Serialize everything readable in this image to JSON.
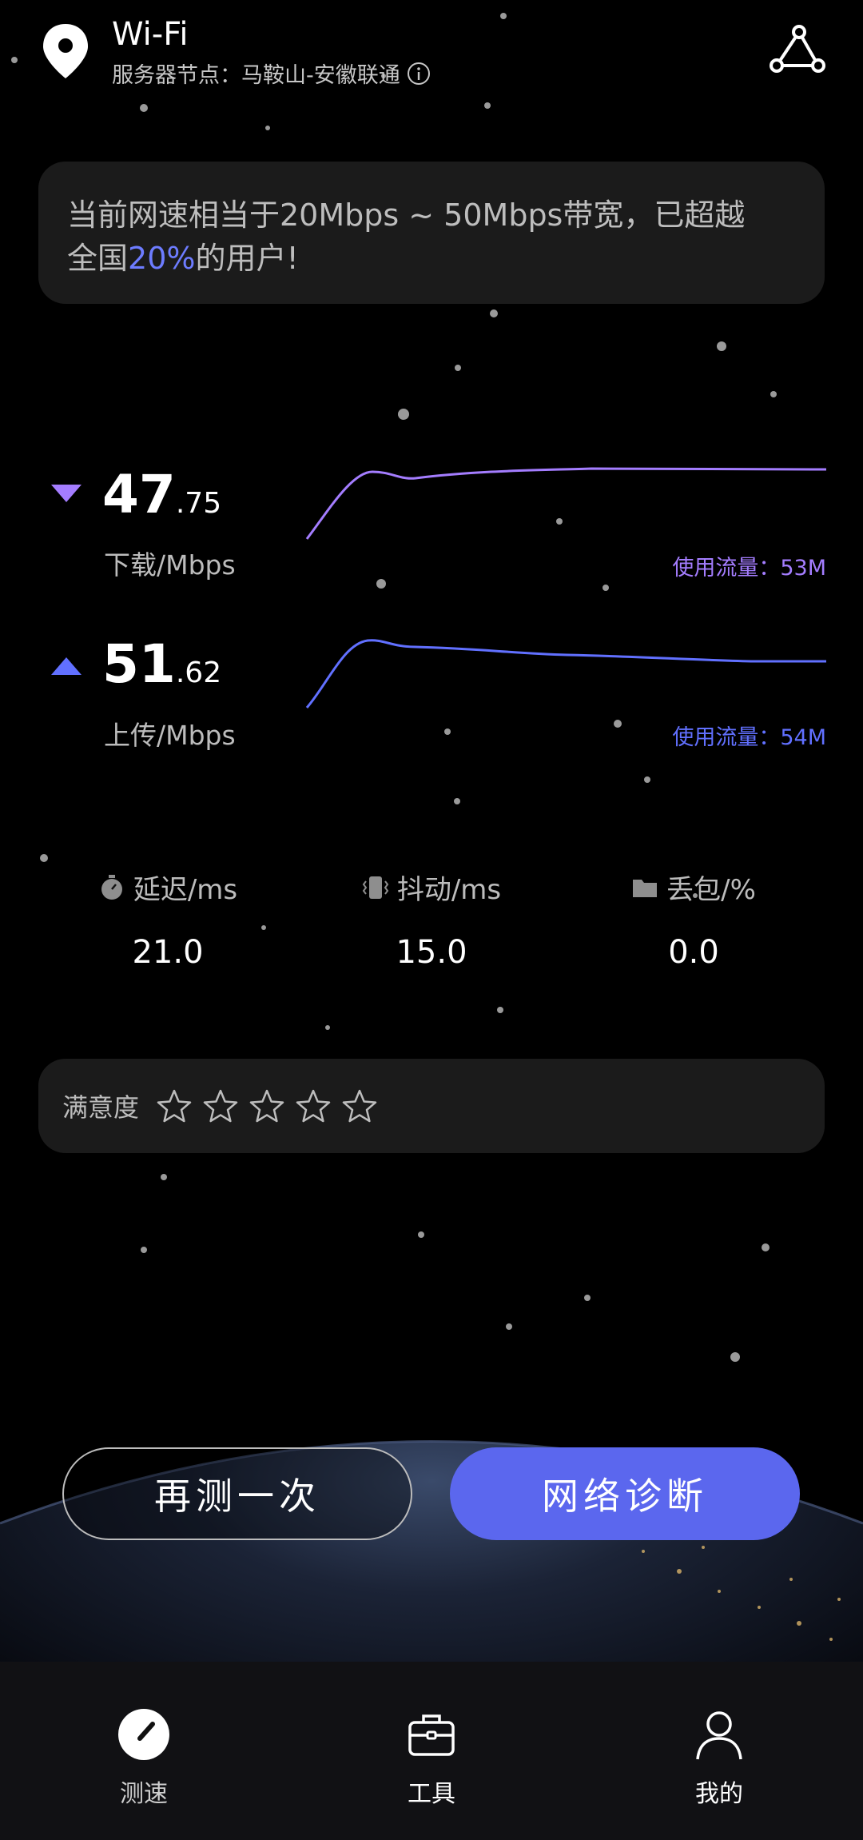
{
  "header": {
    "title": "Wi-Fi",
    "server": "服务器节点：马鞍山-安徽联通"
  },
  "summary": {
    "prefix": "当前网速相当于20Mbps ~ 50Mbps带宽，已超越",
    "line2_start": "全国",
    "percent": "20%",
    "line2_end": "的用户!"
  },
  "download": {
    "value_int": "47",
    "value_dec": ".75",
    "label": "下载/Mbps",
    "usage": "使用流量：53M"
  },
  "upload": {
    "value_int": "51",
    "value_dec": ".62",
    "label": "上传/Mbps",
    "usage": "使用流量：54M"
  },
  "metrics": [
    {
      "label": "延迟/ms",
      "value": "21.0",
      "icon": "stopwatch-icon"
    },
    {
      "label": "抖动/ms",
      "value": "15.0",
      "icon": "vibration-icon"
    },
    {
      "label": "丢包/%",
      "value": "0.0",
      "icon": "folder-icon"
    }
  ],
  "satisfaction": {
    "label": "满意度",
    "stars": 0,
    "max_stars": 5
  },
  "buttons": {
    "retest": "再测一次",
    "diagnose": "网络诊断"
  },
  "nav": [
    {
      "label": "测速",
      "icon": "speedometer-icon",
      "active": true
    },
    {
      "label": "工具",
      "icon": "toolbox-icon",
      "active": false
    },
    {
      "label": "我的",
      "icon": "profile-icon",
      "active": false
    }
  ],
  "colors": {
    "accent": "#5b67ee",
    "download_color": "#a47dff",
    "upload_color": "#6170ff",
    "highlight": "#6d7cff"
  }
}
